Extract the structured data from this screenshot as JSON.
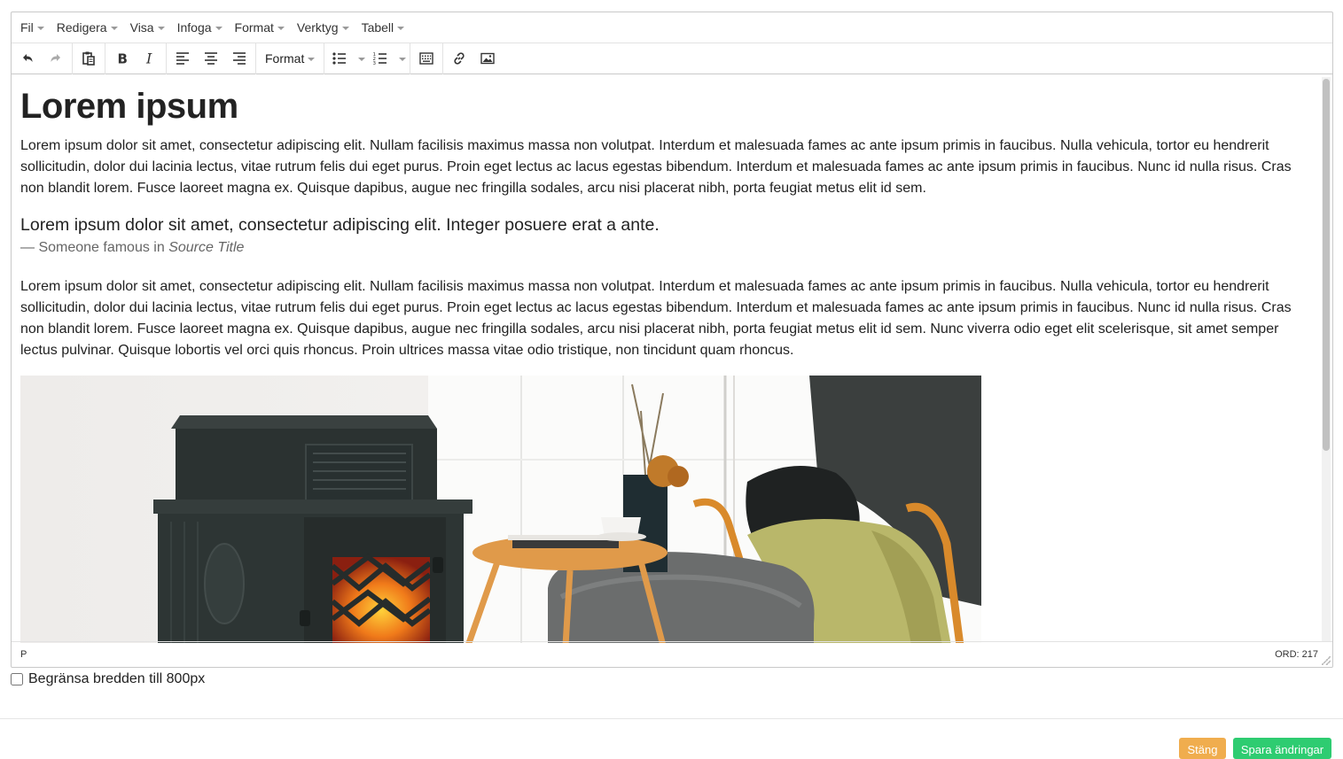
{
  "menubar": {
    "items": [
      "Fil",
      "Redigera",
      "Visa",
      "Infoga",
      "Format",
      "Verktyg",
      "Tabell"
    ]
  },
  "toolbar": {
    "format_label": "Format"
  },
  "content": {
    "heading": "Lorem ipsum",
    "paragraph1": "Lorem ipsum dolor sit amet, consectetur adipiscing elit. Nullam facilisis maximus massa non volutpat. Interdum et malesuada fames ac ante ipsum primis in faucibus. Nulla vehicula, tortor eu hendrerit sollicitudin, dolor dui lacinia lectus, vitae rutrum felis dui eget purus. Proin eget lectus ac lacus egestas bibendum. Interdum et malesuada fames ac ante ipsum primis in faucibus. Nunc id nulla risus. Cras non blandit lorem. Fusce laoreet magna ex. Quisque dapibus, augue nec fringilla sodales, arcu nisi placerat nibh, porta feugiat metus elit id sem.",
    "quote_text": "Lorem ipsum dolor sit amet, consectetur adipiscing elit. Integer posuere erat a ante.",
    "quote_prefix": "— Someone famous in ",
    "quote_source": "Source Title",
    "paragraph2": "Lorem ipsum dolor sit amet, consectetur adipiscing elit. Nullam facilisis maximus massa non volutpat. Interdum et malesuada fames ac ante ipsum primis in faucibus. Nulla vehicula, tortor eu hendrerit sollicitudin, dolor dui lacinia lectus, vitae rutrum felis dui eget purus. Proin eget lectus ac lacus egestas bibendum. Interdum et malesuada fames ac ante ipsum primis in faucibus. Nunc id nulla risus. Cras non blandit lorem. Fusce laoreet magna ex. Quisque dapibus, augue nec fringilla sodales, arcu nisi placerat nibh, porta feugiat metus elit id sem. Nunc viverra odio eget elit scelerisque, sit amet semper lectus pulvinar. Quisque lobortis vel orci quis rhoncus. Proin ultrices massa vitae odio tristique, non tincidunt quam rhoncus."
  },
  "statusbar": {
    "path": "P",
    "wordcount": "ORD: 217"
  },
  "options": {
    "limit_width_label": "Begränsa bredden till 800px"
  },
  "actions": {
    "close_label": "Stäng",
    "save_label": "Spara ändringar"
  },
  "colors": {
    "close_button": "#f0ad4e",
    "save_button": "#2ecc71"
  }
}
